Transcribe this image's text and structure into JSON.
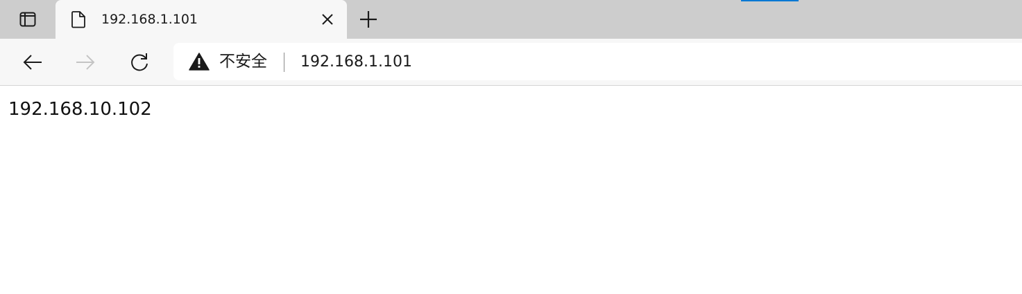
{
  "browser": {
    "tab": {
      "title": "192.168.1.101",
      "favicon": "page-icon"
    },
    "icons": {
      "tab_actions": "tab-actions-icon",
      "close": "close-icon",
      "new_tab": "plus-icon",
      "back": "back-arrow-icon",
      "forward": "forward-arrow-icon",
      "refresh": "refresh-icon",
      "security": "warning-icon"
    },
    "address_bar": {
      "security_label": "不安全",
      "url": "192.168.1.101"
    },
    "colors": {
      "tabbar_bg": "#cdcdcd",
      "toolbar_bg": "#f7f7f7",
      "accent": "#0078d4",
      "forward_disabled": "#c4c4c4"
    }
  },
  "page": {
    "body_text": "192.168.10.102"
  }
}
